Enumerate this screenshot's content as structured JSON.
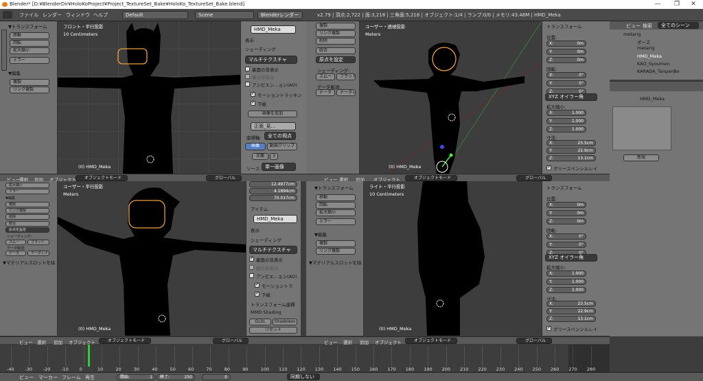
{
  "window": {
    "title": "Blender* [D:¥BlenderDir¥HoloKoProject¥Project_TextureSet_Bake¥HoloKo_TextureSet_Bake.blend]",
    "minimize": "—",
    "maximize": "❐",
    "close": "✕"
  },
  "menu": {
    "file": "ファイル",
    "render": "レンダー",
    "window": "ウィンドウ",
    "help": "ヘルプ",
    "layout": "Default",
    "scene": "Scene",
    "engine": "Blenderレンダー",
    "stats": "v2.79 | 頂点:2,722 | 面:3,218 | 三角面:5,216 | オブジェクト:1/4 | ランプ:0/0 | メモリ:43.48M | HMD_Meka"
  },
  "toolshelf_top": {
    "transform": "▼トランスフォーム",
    "move": "移動",
    "rotate": "回転",
    "scale": "拡大縮小",
    "mirror": "ミラー",
    "edit": "▼編集",
    "duplicate": "複製",
    "link_dup": "リンク複製"
  },
  "viewport_tl": {
    "title": "フロント・平行投影",
    "scale": "10 Centimeters",
    "object": "(0) HMD_Meka"
  },
  "viewport_tr": {
    "title": "ユーザー・透視投影",
    "scale": "Meters",
    "object": "(0) HMD_Meka"
  },
  "viewport_bl": {
    "title": "ユーザー・平行投影",
    "scale": "Meters",
    "object": "(0) HMD_Meka"
  },
  "viewport_br": {
    "title": "ライト・平行投影",
    "scale": "10 Centimeters",
    "object": "(0) HMD_Meka"
  },
  "tools_tr": {
    "dup": "複製",
    "linkdup": "リンク複製",
    "delete": "削除",
    "join": "統合",
    "origin": "原点を設定",
    "shading": "シェーディング:",
    "smooth": "スムー",
    "flat": "フラット",
    "data_transfer": "データ転送:",
    "data": "データ",
    "data_layer": "データレイ"
  },
  "props_tl": {
    "object": "HMD_Meka",
    "display": "表示",
    "shading": "シェーディング",
    "multitex": "マルチテクスチャ",
    "backface": "裏面の非表示",
    "wire_hidden": "線分非表示",
    "ao": "アンビエン...ョン(AO)",
    "motion": "モーショントラッキン",
    "bg": "下絵",
    "add_image": "画像を追加",
    "front_view": "正面_見...",
    "axis": "座標軸:",
    "all_views": "全ての視点",
    "image": "画像",
    "movie": "動画クリップ",
    "front": "正面",
    "num": "3",
    "source": "ソース:",
    "single": "単一画像"
  },
  "props_bl": {
    "y_val": "4.1894cm",
    "z_val": "70.017cm",
    "x_val": "12.4977cm",
    "item": "アイテム",
    "object": "HMD_Meka",
    "display": "表示",
    "shading": "シェーディング",
    "multitex": "マルチテクスチャ",
    "backface": "裏面の非表示",
    "wire_hidden": "線分非表示",
    "ao": "アンビエ...ョン(AO)",
    "motion": "モーショントラ",
    "bg": "下絵",
    "transform_orient": "トランスフォーム座標",
    "mmd": "MMD Shading",
    "glsl": "GLSL",
    "shadeless": "Shadeless",
    "reset": "リセット"
  },
  "props_transform": {
    "title": "トランスフォーム",
    "location": "位置:",
    "rotation": "回転:",
    "rotmode": "XYZ オイラー角",
    "scale": "拡大縮小:",
    "dimensions": "寸法:",
    "x": "X:",
    "y": "Y:",
    "z": "Z:",
    "loc_x": "0m",
    "loc_y": "0m",
    "loc_z": "0m",
    "rot_x": "0°",
    "rot_y": "0°",
    "rot_z": "0°",
    "sc_x": "1.000",
    "sc_y": "1.000",
    "sc_z": "1.000",
    "dim_x": "23.5cm",
    "dim_y": "22.9cm",
    "dim_z": "13.1cm",
    "gpencil": "グリースペンシルレイ"
  },
  "outliner": {
    "view": "ビュー",
    "search": "検索",
    "all_scenes": "全てのシーン",
    "items": [
      "metarig",
      "ポーズ",
      "metarig",
      "HMD_Meka",
      "KAO_Syoumen",
      "KARADA_TanpanBo"
    ]
  },
  "props_editor": {
    "object": "HMD_Meka",
    "new": "新規"
  },
  "viewheader": {
    "view": "ビュー",
    "select": "選択",
    "add": "追加",
    "object": "オブジェクト",
    "mode": "オブジェクトモード",
    "global": "グローバル"
  },
  "timeline": {
    "ticks": [
      "-40",
      "-30",
      "-20",
      "-10",
      "0",
      "10",
      "20",
      "30",
      "40",
      "50",
      "60",
      "70",
      "80",
      "90",
      "100",
      "110",
      "120",
      "130",
      "140",
      "150",
      "160",
      "170",
      "180",
      "190",
      "200",
      "210",
      "220",
      "230",
      "240",
      "250",
      "260",
      "270",
      "280"
    ],
    "view": "ビュー",
    "marker": "マーカー",
    "frame": "フレーム",
    "play": "再生",
    "start_label": "開始:",
    "start": "1",
    "end_label": "終了:",
    "end": "250",
    "current": "0",
    "sync": "同期しない"
  },
  "shelf_bl": {
    "scale": "拡大縮小",
    "mirror": "ミラー",
    "edit": "▼編集",
    "dup": "複製",
    "linkdup": "リンク複製",
    "delete": "削除",
    "join": "統合",
    "origin": "原点を設定",
    "shading": "シェーディング:",
    "smooth": "スムー",
    "flat": "フラット",
    "datatransfer": "データ転送:",
    "data": "データ",
    "datalayer": "データレイ",
    "matslot": "▼マテリアルスロットを除"
  },
  "tools_br": {
    "transform": "▼トランスフォーム",
    "move": "移動",
    "rotate": "回転",
    "scale": "拡大縮小",
    "mirror": "ミラー",
    "edit": "▼編集",
    "dup": "複製",
    "linkdup": "リンク複製",
    "matslot": "▼マテリアルスロットを除"
  }
}
